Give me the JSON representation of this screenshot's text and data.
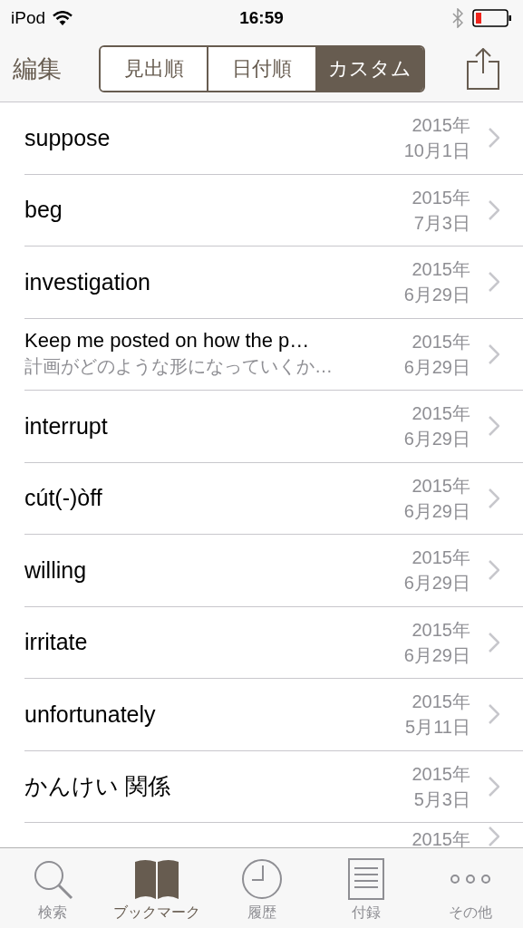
{
  "status_bar": {
    "carrier": "iPod",
    "time": "16:59"
  },
  "nav_bar": {
    "edit": "編集",
    "segments": [
      {
        "label": "見出順",
        "selected": false
      },
      {
        "label": "日付順",
        "selected": false
      },
      {
        "label": "カスタム",
        "selected": true
      }
    ]
  },
  "rows": [
    {
      "title": "suppose",
      "year": "2015年",
      "date": "10月1日"
    },
    {
      "title": "beg",
      "year": "2015年",
      "date": "7月3日"
    },
    {
      "title": "investigation",
      "year": "2015年",
      "date": "6月29日"
    },
    {
      "title": "Keep me posted on how the p…",
      "subtitle": "計画がどのような形になっていくか…",
      "year": "2015年",
      "date": "6月29日"
    },
    {
      "title": "interrupt",
      "year": "2015年",
      "date": "6月29日"
    },
    {
      "title": "cút(-)òff",
      "year": "2015年",
      "date": "6月29日"
    },
    {
      "title": "willing",
      "year": "2015年",
      "date": "6月29日"
    },
    {
      "title": "irritate",
      "year": "2015年",
      "date": "6月29日"
    },
    {
      "title": "unfortunately",
      "year": "2015年",
      "date": "5月11日"
    },
    {
      "title": "かんけい 関係",
      "year": "2015年",
      "date": "5月3日"
    },
    {
      "year": "2015年"
    }
  ],
  "tab_bar": [
    {
      "kind": "search",
      "label": "検索",
      "selected": false
    },
    {
      "kind": "bookmark",
      "label": "ブックマーク",
      "selected": true
    },
    {
      "kind": "history",
      "label": "履歴",
      "selected": false
    },
    {
      "kind": "appendix",
      "label": "付録",
      "selected": false
    },
    {
      "kind": "more",
      "label": "その他",
      "selected": false
    }
  ]
}
